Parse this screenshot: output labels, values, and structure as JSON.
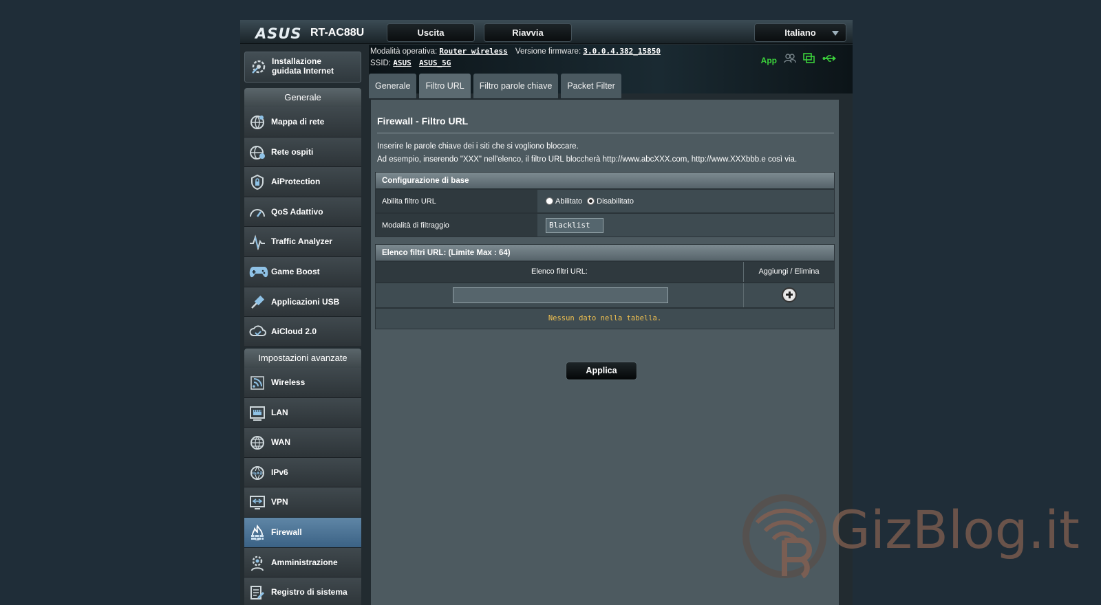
{
  "header": {
    "brand": "ASUS",
    "model": "RT-AC88U",
    "exit_label": "Uscita",
    "reboot_label": "Riavvia",
    "language": "Italiano"
  },
  "info": {
    "mode_label": "Modalità operativa:",
    "mode_value": "Router wireless",
    "firmware_label": "Versione firmware:",
    "firmware_value": "3.0.0.4.382_15850",
    "ssid_label": "SSID:",
    "ssid_1": "ASUS",
    "ssid_2": "ASUS_5G",
    "app_label": "App"
  },
  "sidebar": {
    "quick_setup_line1": "Installazione",
    "quick_setup_line2": "guidata Internet",
    "general_heading": "Generale",
    "general_items": [
      {
        "label": "Mappa di rete",
        "icon": "network-map-icon"
      },
      {
        "label": "Rete ospiti",
        "icon": "guest-network-icon"
      },
      {
        "label": "AiProtection",
        "icon": "lock-shield-icon"
      },
      {
        "label": "QoS Adattivo",
        "icon": "gauge-icon"
      },
      {
        "label": "Traffic Analyzer",
        "icon": "pulse-icon"
      },
      {
        "label": "Game Boost",
        "icon": "gamepad-icon"
      },
      {
        "label": "Applicazioni USB",
        "icon": "usb-icon"
      },
      {
        "label": "AiCloud 2.0",
        "icon": "cloud-icon"
      }
    ],
    "advanced_heading": "Impostazioni avanzate",
    "advanced_items": [
      {
        "label": "Wireless",
        "icon": "wireless-icon"
      },
      {
        "label": "LAN",
        "icon": "lan-icon"
      },
      {
        "label": "WAN",
        "icon": "globe-icon"
      },
      {
        "label": "IPv6",
        "icon": "ipv6-icon"
      },
      {
        "label": "VPN",
        "icon": "vpn-icon"
      },
      {
        "label": "Firewall",
        "icon": "firewall-icon",
        "active": true
      },
      {
        "label": "Amministrazione",
        "icon": "admin-gear-icon"
      },
      {
        "label": "Registro di sistema",
        "icon": "log-icon"
      }
    ]
  },
  "tabs": [
    {
      "label": "Generale",
      "active": false
    },
    {
      "label": "Filtro URL",
      "active": true
    },
    {
      "label": "Filtro parole chiave",
      "active": false
    },
    {
      "label": "Packet Filter",
      "active": false
    }
  ],
  "main": {
    "title": "Firewall - Filtro URL",
    "desc_line1": "Inserire le parole chiave dei i siti che si vogliono bloccare.",
    "desc_line2": "Ad esempio, inserendo \"XXX\" nell'elenco, il filtro URL bloccherà http://www.abcXXX.com, http://www.XXXbbb.e così via.",
    "basic_config_heading": "Configurazione di base",
    "enable_label": "Abilita filtro URL",
    "enabled_option": "Abilitato",
    "disabled_option": "Disabilitato",
    "enabled_selected": false,
    "mode_label": "Modalità di filtraggio",
    "mode_value": "Blacklist",
    "list_heading": "Elenco filtri URL: (Limite Max : 64)",
    "col_url": "Elenco filtri URL:",
    "col_action": "Aggiungi / Elimina",
    "url_input_value": "",
    "empty_message": "Nessun dato nella tabella.",
    "apply_label": "Applica"
  },
  "watermark": {
    "text": "GizBlog.it"
  },
  "colors": {
    "active_menu": "#4f7aa0",
    "status_green": "#3bd13b",
    "empty_text": "#f0c050"
  }
}
